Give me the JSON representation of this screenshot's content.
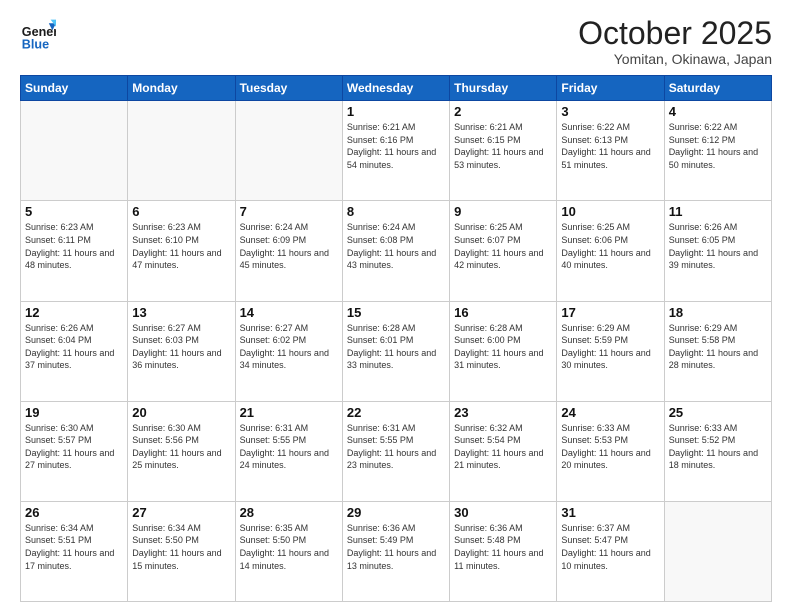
{
  "header": {
    "logo_line1": "General",
    "logo_line2": "Blue",
    "month_title": "October 2025",
    "location": "Yomitan, Okinawa, Japan"
  },
  "weekdays": [
    "Sunday",
    "Monday",
    "Tuesday",
    "Wednesday",
    "Thursday",
    "Friday",
    "Saturday"
  ],
  "weeks": [
    [
      {
        "day": "",
        "info": ""
      },
      {
        "day": "",
        "info": ""
      },
      {
        "day": "",
        "info": ""
      },
      {
        "day": "1",
        "info": "Sunrise: 6:21 AM\nSunset: 6:16 PM\nDaylight: 11 hours\nand 54 minutes."
      },
      {
        "day": "2",
        "info": "Sunrise: 6:21 AM\nSunset: 6:15 PM\nDaylight: 11 hours\nand 53 minutes."
      },
      {
        "day": "3",
        "info": "Sunrise: 6:22 AM\nSunset: 6:13 PM\nDaylight: 11 hours\nand 51 minutes."
      },
      {
        "day": "4",
        "info": "Sunrise: 6:22 AM\nSunset: 6:12 PM\nDaylight: 11 hours\nand 50 minutes."
      }
    ],
    [
      {
        "day": "5",
        "info": "Sunrise: 6:23 AM\nSunset: 6:11 PM\nDaylight: 11 hours\nand 48 minutes."
      },
      {
        "day": "6",
        "info": "Sunrise: 6:23 AM\nSunset: 6:10 PM\nDaylight: 11 hours\nand 47 minutes."
      },
      {
        "day": "7",
        "info": "Sunrise: 6:24 AM\nSunset: 6:09 PM\nDaylight: 11 hours\nand 45 minutes."
      },
      {
        "day": "8",
        "info": "Sunrise: 6:24 AM\nSunset: 6:08 PM\nDaylight: 11 hours\nand 43 minutes."
      },
      {
        "day": "9",
        "info": "Sunrise: 6:25 AM\nSunset: 6:07 PM\nDaylight: 11 hours\nand 42 minutes."
      },
      {
        "day": "10",
        "info": "Sunrise: 6:25 AM\nSunset: 6:06 PM\nDaylight: 11 hours\nand 40 minutes."
      },
      {
        "day": "11",
        "info": "Sunrise: 6:26 AM\nSunset: 6:05 PM\nDaylight: 11 hours\nand 39 minutes."
      }
    ],
    [
      {
        "day": "12",
        "info": "Sunrise: 6:26 AM\nSunset: 6:04 PM\nDaylight: 11 hours\nand 37 minutes."
      },
      {
        "day": "13",
        "info": "Sunrise: 6:27 AM\nSunset: 6:03 PM\nDaylight: 11 hours\nand 36 minutes."
      },
      {
        "day": "14",
        "info": "Sunrise: 6:27 AM\nSunset: 6:02 PM\nDaylight: 11 hours\nand 34 minutes."
      },
      {
        "day": "15",
        "info": "Sunrise: 6:28 AM\nSunset: 6:01 PM\nDaylight: 11 hours\nand 33 minutes."
      },
      {
        "day": "16",
        "info": "Sunrise: 6:28 AM\nSunset: 6:00 PM\nDaylight: 11 hours\nand 31 minutes."
      },
      {
        "day": "17",
        "info": "Sunrise: 6:29 AM\nSunset: 5:59 PM\nDaylight: 11 hours\nand 30 minutes."
      },
      {
        "day": "18",
        "info": "Sunrise: 6:29 AM\nSunset: 5:58 PM\nDaylight: 11 hours\nand 28 minutes."
      }
    ],
    [
      {
        "day": "19",
        "info": "Sunrise: 6:30 AM\nSunset: 5:57 PM\nDaylight: 11 hours\nand 27 minutes."
      },
      {
        "day": "20",
        "info": "Sunrise: 6:30 AM\nSunset: 5:56 PM\nDaylight: 11 hours\nand 25 minutes."
      },
      {
        "day": "21",
        "info": "Sunrise: 6:31 AM\nSunset: 5:55 PM\nDaylight: 11 hours\nand 24 minutes."
      },
      {
        "day": "22",
        "info": "Sunrise: 6:31 AM\nSunset: 5:55 PM\nDaylight: 11 hours\nand 23 minutes."
      },
      {
        "day": "23",
        "info": "Sunrise: 6:32 AM\nSunset: 5:54 PM\nDaylight: 11 hours\nand 21 minutes."
      },
      {
        "day": "24",
        "info": "Sunrise: 6:33 AM\nSunset: 5:53 PM\nDaylight: 11 hours\nand 20 minutes."
      },
      {
        "day": "25",
        "info": "Sunrise: 6:33 AM\nSunset: 5:52 PM\nDaylight: 11 hours\nand 18 minutes."
      }
    ],
    [
      {
        "day": "26",
        "info": "Sunrise: 6:34 AM\nSunset: 5:51 PM\nDaylight: 11 hours\nand 17 minutes."
      },
      {
        "day": "27",
        "info": "Sunrise: 6:34 AM\nSunset: 5:50 PM\nDaylight: 11 hours\nand 15 minutes."
      },
      {
        "day": "28",
        "info": "Sunrise: 6:35 AM\nSunset: 5:50 PM\nDaylight: 11 hours\nand 14 minutes."
      },
      {
        "day": "29",
        "info": "Sunrise: 6:36 AM\nSunset: 5:49 PM\nDaylight: 11 hours\nand 13 minutes."
      },
      {
        "day": "30",
        "info": "Sunrise: 6:36 AM\nSunset: 5:48 PM\nDaylight: 11 hours\nand 11 minutes."
      },
      {
        "day": "31",
        "info": "Sunrise: 6:37 AM\nSunset: 5:47 PM\nDaylight: 11 hours\nand 10 minutes."
      },
      {
        "day": "",
        "info": ""
      }
    ]
  ]
}
